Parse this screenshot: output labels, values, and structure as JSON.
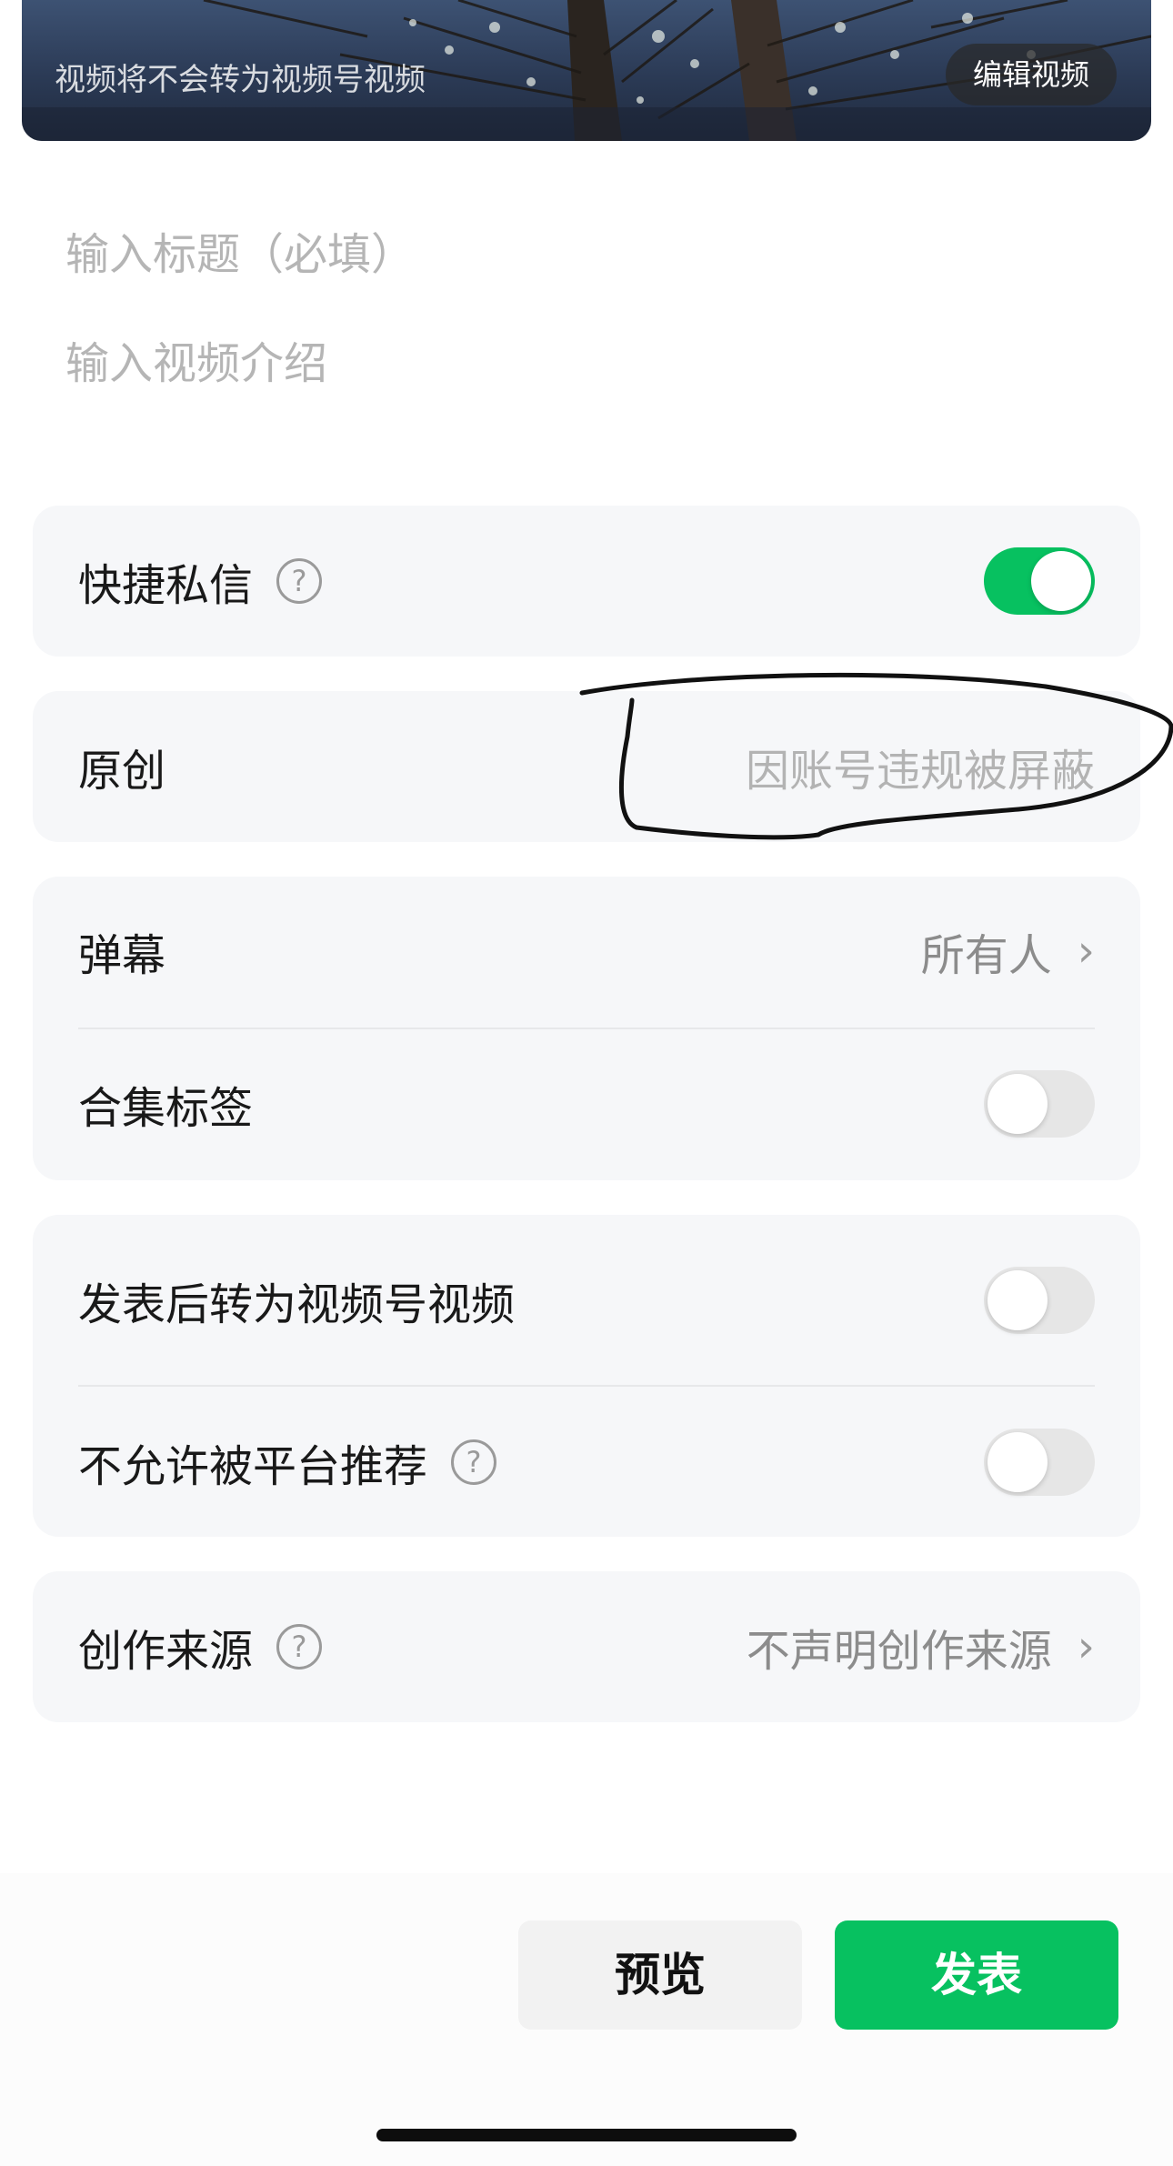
{
  "video": {
    "note": "视频将不会转为视频号视频",
    "edit_label": "编辑视频"
  },
  "form": {
    "title_placeholder": "输入标题（必填）",
    "desc_placeholder": "输入视频介绍"
  },
  "settings": {
    "quick_message": {
      "label": "快捷私信",
      "enabled": true
    },
    "original": {
      "label": "原创",
      "value": "因账号违规被屏蔽"
    },
    "danmaku": {
      "label": "弹幕",
      "value": "所有人"
    },
    "collection_tag": {
      "label": "合集标签",
      "enabled": false
    },
    "convert_after_publish": {
      "label": "发表后转为视频号视频",
      "enabled": false
    },
    "no_recommend": {
      "label": "不允许被平台推荐",
      "enabled": false
    },
    "creation_source": {
      "label": "创作来源",
      "value": "不声明创作来源"
    }
  },
  "actions": {
    "preview_label": "预览",
    "publish_label": "发表"
  },
  "colors": {
    "accent": "#07c160",
    "card_bg": "#f6f7f9"
  }
}
